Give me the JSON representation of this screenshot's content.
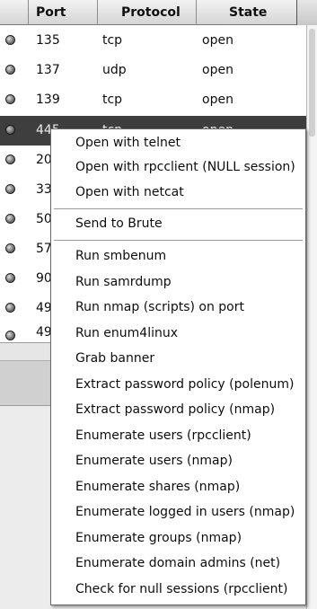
{
  "table": {
    "columns": [
      "Port",
      "Protocol",
      "State"
    ],
    "rows": [
      {
        "port": "135",
        "protocol": "tcp",
        "state": "open"
      },
      {
        "port": "137",
        "protocol": "udp",
        "state": "open"
      },
      {
        "port": "139",
        "protocol": "tcp",
        "state": "open"
      },
      {
        "port": "445",
        "protocol": "tcp",
        "state": "open"
      },
      {
        "port": "20",
        "protocol": "",
        "state": ""
      },
      {
        "port": "33",
        "protocol": "",
        "state": ""
      },
      {
        "port": "50",
        "protocol": "",
        "state": ""
      },
      {
        "port": "57",
        "protocol": "",
        "state": ""
      },
      {
        "port": "90",
        "protocol": "",
        "state": ""
      },
      {
        "port": "49",
        "protocol": "",
        "state": ""
      },
      {
        "port": "49",
        "protocol": "",
        "state": ""
      }
    ]
  },
  "context_menu": {
    "group1": [
      "Open with telnet",
      "Open with rpcclient (NULL session)",
      "Open with netcat"
    ],
    "group2": [
      "Send to Brute"
    ],
    "group3": [
      "Run smbenum",
      "Run samrdump",
      "Run nmap (scripts) on port",
      "Run enum4linux",
      "Grab banner",
      "Extract password policy (polenum)",
      "Extract password policy (nmap)",
      "Enumerate users (rpcclient)",
      "Enumerate users (nmap)",
      "Enumerate shares (nmap)",
      "Enumerate logged in users (nmap)",
      "Enumerate groups (nmap)",
      "Enumerate domain admins (net)",
      "Check for null sessions (rpcclient)"
    ]
  }
}
